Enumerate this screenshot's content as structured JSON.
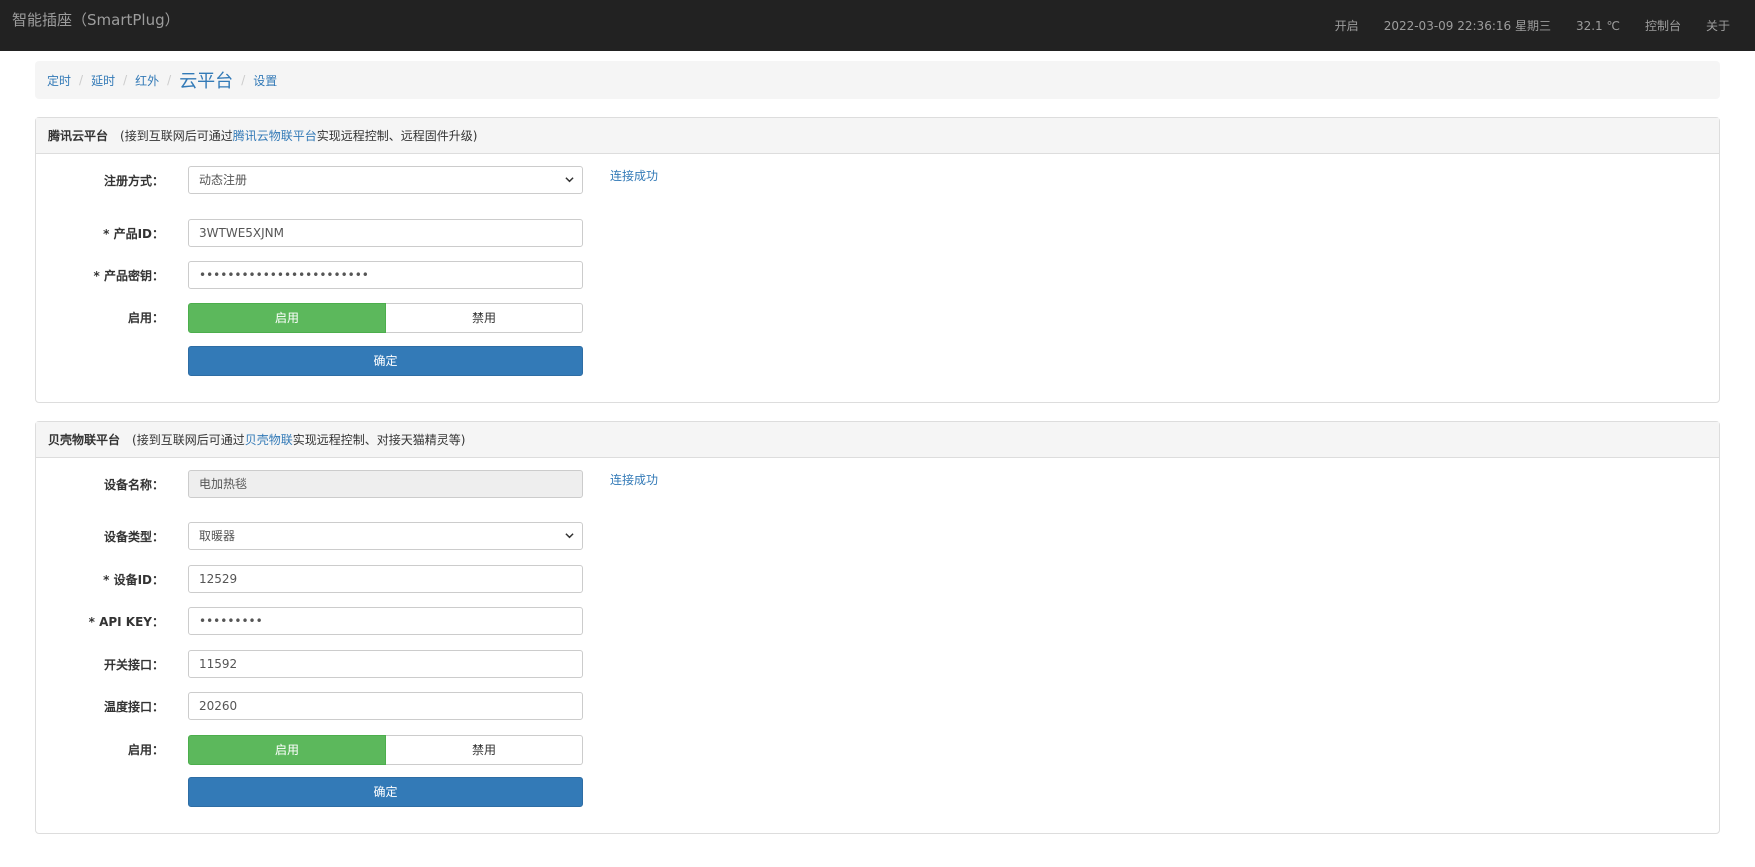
{
  "navbar": {
    "brand": "智能插座（SmartPlug）",
    "power": "开启",
    "datetime": "2022-03-09 22:36:16 星期三",
    "temperature": "32.1 ℃",
    "console": "控制台",
    "about": "关于"
  },
  "breadcrumb": {
    "items": [
      "定时",
      "延时",
      "红外",
      "云平台",
      "设置"
    ],
    "active": "云平台"
  },
  "tencent": {
    "title": "腾讯云平台",
    "desc_prefix": "(接到互联网后可通过",
    "desc_link": "腾讯云物联平台",
    "desc_suffix": "实现远程控制、远程固件升级)",
    "reg_label": "注册方式：",
    "reg_value": "动态注册",
    "status": "连接成功",
    "product_id_label": "* 产品ID：",
    "product_id_value": "3WTWE5XJNM",
    "product_key_label": "* 产品密钥：",
    "product_key_value": "••••••••••••••••••••••••",
    "enable_label": "启用：",
    "enable_on": "启用",
    "enable_off": "禁用",
    "confirm": "确定"
  },
  "bemfa": {
    "title": "贝壳物联平台",
    "desc_prefix": "(接到互联网后可通过",
    "desc_link": "贝壳物联",
    "desc_suffix": "实现远程控制、对接天猫精灵等)",
    "name_label": "设备名称：",
    "name_value": "电加热毯",
    "status": "连接成功",
    "type_label": "设备类型：",
    "type_value": "取暖器",
    "device_id_label": "* 设备ID：",
    "device_id_value": "12529",
    "apikey_label": "* API KEY：",
    "apikey_value": "•••••••••",
    "switch_label": "开关接口：",
    "switch_value": "11592",
    "temp_label": "温度接口：",
    "temp_value": "20260",
    "enable_label": "启用：",
    "enable_on": "启用",
    "enable_off": "禁用",
    "confirm": "确定"
  },
  "colors": {
    "navbar": "#222222",
    "link": "#337ab7",
    "success": "#5cb85c",
    "primary": "#337ab7"
  }
}
